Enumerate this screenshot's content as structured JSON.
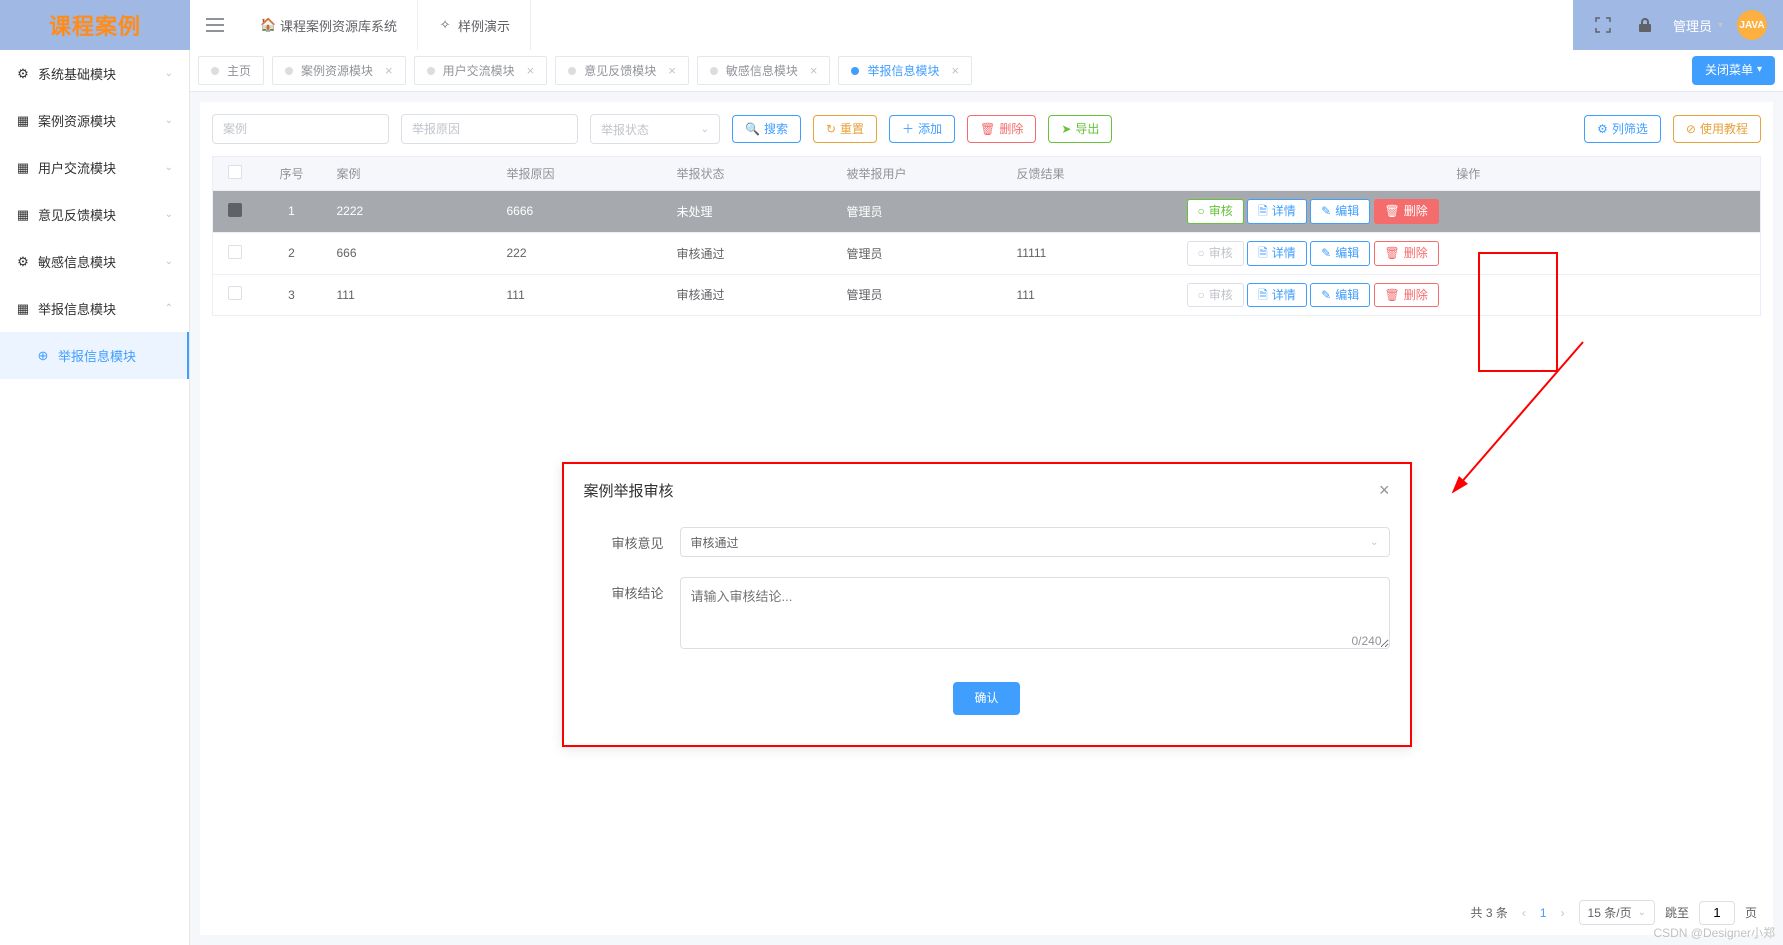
{
  "app": {
    "logo": "课程案例"
  },
  "topnav": {
    "menu1_label": "课程案例资源库系统",
    "menu2_label": "样例演示"
  },
  "topright": {
    "admin_label": "管理员",
    "avatar_text": "JAVA"
  },
  "sidebar": {
    "items": [
      {
        "label": "系统基础模块"
      },
      {
        "label": "案例资源模块"
      },
      {
        "label": "用户交流模块"
      },
      {
        "label": "意见反馈模块"
      },
      {
        "label": "敏感信息模块"
      },
      {
        "label": "举报信息模块"
      }
    ],
    "sub_active": "举报信息模块"
  },
  "tabs": {
    "items": [
      {
        "label": "主页",
        "closable": false
      },
      {
        "label": "案例资源模块",
        "closable": true
      },
      {
        "label": "用户交流模块",
        "closable": true
      },
      {
        "label": "意见反馈模块",
        "closable": true
      },
      {
        "label": "敏感信息模块",
        "closable": true
      },
      {
        "label": "举报信息模块",
        "closable": true,
        "active": true
      }
    ],
    "close_menu_label": "关闭菜单"
  },
  "search": {
    "case_ph": "案例",
    "reason_ph": "举报原因",
    "status_ph": "举报状态",
    "search_btn": "搜索",
    "reset_btn": "重置",
    "add_btn": "添加",
    "del_btn": "删除",
    "export_btn": "导出",
    "filter_btn": "列筛选",
    "help_btn": "使用教程"
  },
  "table": {
    "cols": {
      "idx": "序号",
      "case": "案例",
      "reason": "举报原因",
      "status": "举报状态",
      "user": "被举报用户",
      "feedback": "反馈结果",
      "ops": "操作"
    },
    "op_btns": {
      "review": "审核",
      "detail": "详情",
      "edit": "编辑",
      "del": "删除"
    },
    "rows": [
      {
        "idx": "1",
        "case": "2222",
        "reason": "6666",
        "status": "未处理",
        "user": "管理员",
        "feedback": ""
      },
      {
        "idx": "2",
        "case": "666",
        "reason": "222",
        "status": "审核通过",
        "user": "管理员",
        "feedback": "11111"
      },
      {
        "idx": "3",
        "case": "111",
        "reason": "111",
        "status": "审核通过",
        "user": "管理员",
        "feedback": "111"
      }
    ]
  },
  "dialog": {
    "title": "案例举报审核",
    "opinion_label": "审核意见",
    "opinion_value": "审核通过",
    "result_label": "审核结论",
    "result_ph": "请输入审核结论...",
    "counter": "0/240",
    "confirm": "确认"
  },
  "pager": {
    "total_text": "共 3 条",
    "page": "1",
    "page_size": "15 条/页",
    "jump_label": "跳至",
    "jump_val": "1",
    "page_suffix": "页"
  },
  "watermark": "CSDN @Designer小郑"
}
